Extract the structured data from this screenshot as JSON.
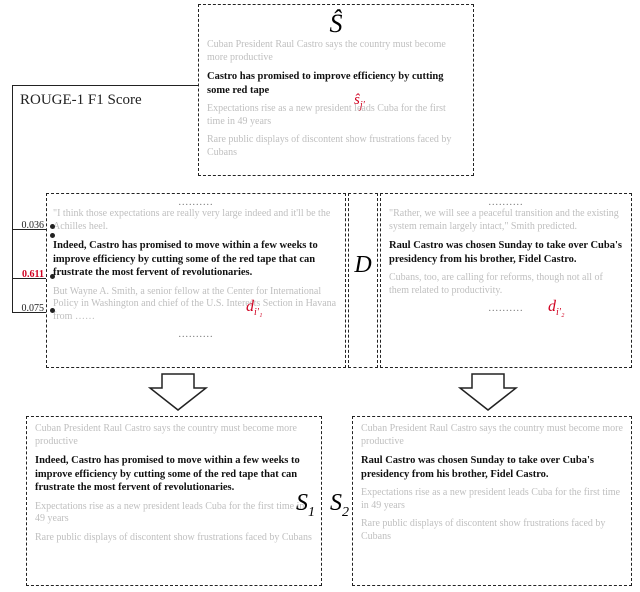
{
  "metric_label": "ROUGE-1 F1 Score",
  "scores": {
    "top": "0.036",
    "mid": "0.611",
    "bot": "0.075"
  },
  "sym": {
    "Shat": "Ŝ",
    "sj_hat": "ŝ",
    "sj_sub": "j′",
    "D": "D",
    "di1": "d",
    "di1_sub": "i′₁",
    "di2": "d",
    "di2_sub": "i′₂",
    "S1": "S",
    "S1_sub": "1",
    "S2": "S",
    "S2_sub": "2"
  },
  "text": {
    "cuban_president": "Cuban President Raul Castro says the country must become more productive",
    "castro_bold_short": "Castro has promised to improve efficiency by cutting some red tape",
    "expectations": "Expectations rise as a new president leads Cuba for the first time in 49 years",
    "rare_public": "Rare public displays of discontent show frustrations faced by Cubans",
    "think_expect": "\"I think those expectations are really very large indeed and it'll be the Achilles heel.",
    "indeed_bold": "Indeed, Castro has promised to move within a few weeks to improve efficiency by cutting some of the red tape that can frustrate the most fervent of revolutionaries.",
    "wayne": "But Wayne A. Smith, a senior fellow at the Center for International Policy in Washington and chief of the U.S. Interests Section in Havana from ……",
    "rather": "\"Rather, we will see a peaceful transition and the existing system remain largely intact,\" Smith predicted.",
    "raul_bold": "Raul Castro was chosen Sunday to take over Cuba's presidency from his brother, Fidel Castro.",
    "cubans_too": "Cubans, too, are calling for reforms, though not all of them related to productivity.",
    "dots": "..........",
    "dots2": ".........."
  }
}
